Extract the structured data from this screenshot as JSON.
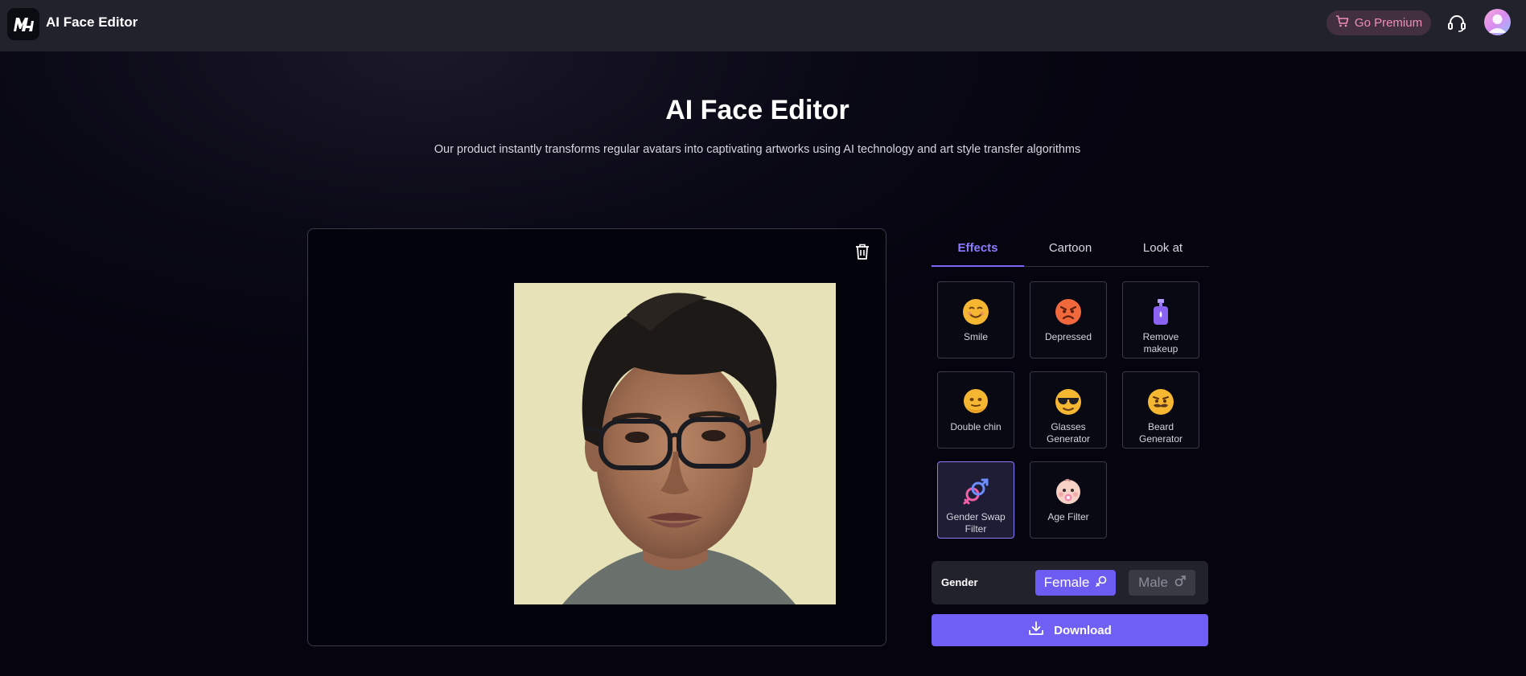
{
  "app": {
    "title": "AI Face Editor",
    "premium_label": "Go Premium"
  },
  "hero": {
    "title": "AI Face Editor",
    "subtitle": "Our product instantly transforms regular avatars into captivating artworks using AI technology and art style transfer algorithms"
  },
  "tabs": [
    {
      "label": "Effects",
      "active": true
    },
    {
      "label": "Cartoon",
      "active": false
    },
    {
      "label": "Look at",
      "active": false
    }
  ],
  "effects": [
    {
      "label": "Smile",
      "icon": "smile-emoji-icon"
    },
    {
      "label": "Depressed",
      "icon": "angry-emoji-icon"
    },
    {
      "label": "Remove makeup",
      "icon": "lotion-bottle-icon"
    },
    {
      "label": "Double chin",
      "icon": "double-chin-emoji-icon"
    },
    {
      "label": "Glasses Generator",
      "icon": "sunglasses-emoji-icon"
    },
    {
      "label": "Beard Generator",
      "icon": "beard-emoji-icon"
    },
    {
      "label": "Gender Swap Filter",
      "icon": "gender-symbol-icon",
      "selected": true
    },
    {
      "label": "Age Filter",
      "icon": "baby-face-icon"
    }
  ],
  "gender": {
    "label": "Gender",
    "female_label": "Female",
    "male_label": "Male",
    "selected": "Female"
  },
  "download_label": "Download",
  "colors": {
    "accent": "#6f5ff5",
    "tab_active": "#8a7cff",
    "premium_text": "#f08db9",
    "topbar_bg": "#22222d",
    "page_bg": "#05040f"
  }
}
